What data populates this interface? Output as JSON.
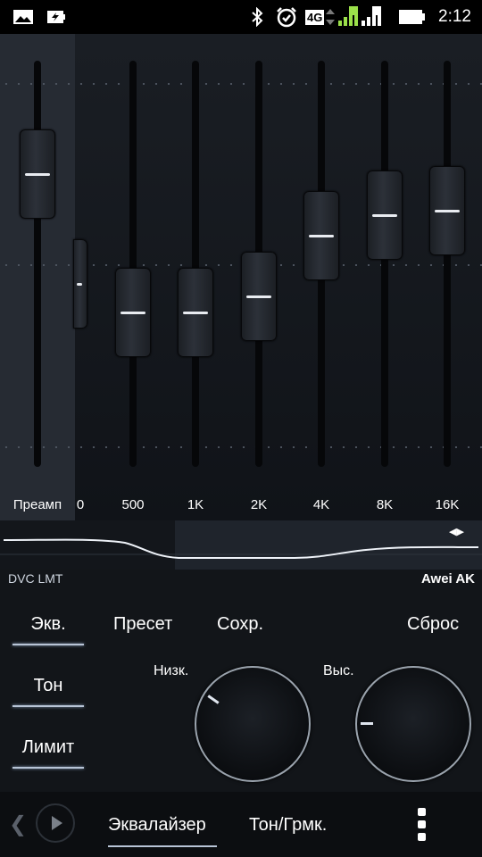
{
  "status_bar": {
    "time": "2:12",
    "network_label": "4G",
    "sim1_label": "1",
    "sim2_label": "2",
    "icons": [
      "image-icon",
      "battery-saver-icon",
      "bluetooth-icon",
      "alarm-icon",
      "signal-icon",
      "battery-icon"
    ]
  },
  "equalizer": {
    "preamp_label": "Преамп",
    "bands": [
      {
        "label": "0",
        "level": 0.55
      },
      {
        "label": "500",
        "level": 0.62
      },
      {
        "label": "1K",
        "level": 0.62
      },
      {
        "label": "2K",
        "level": 0.58
      },
      {
        "label": "4K",
        "level": 0.43
      },
      {
        "label": "8K",
        "level": 0.38
      },
      {
        "label": "16K",
        "level": 0.37
      }
    ],
    "preamp_level": 0.28
  },
  "info": {
    "left": "DVC LMT",
    "right": "Awei AK"
  },
  "modes": {
    "eq": "Экв.",
    "tone": "Тон",
    "limit": "Лимит"
  },
  "actions": {
    "preset": "Пресет",
    "save": "Сохр.",
    "reset": "Сброс"
  },
  "dials": {
    "low_label": "Низк.",
    "high_label": "Выс."
  },
  "bottom_nav": {
    "equalizer": "Эквалайзер",
    "tone_volume": "Тон/Грмк."
  },
  "colors": {
    "accent_underline": "#b8c4d6",
    "background": "#121519"
  }
}
